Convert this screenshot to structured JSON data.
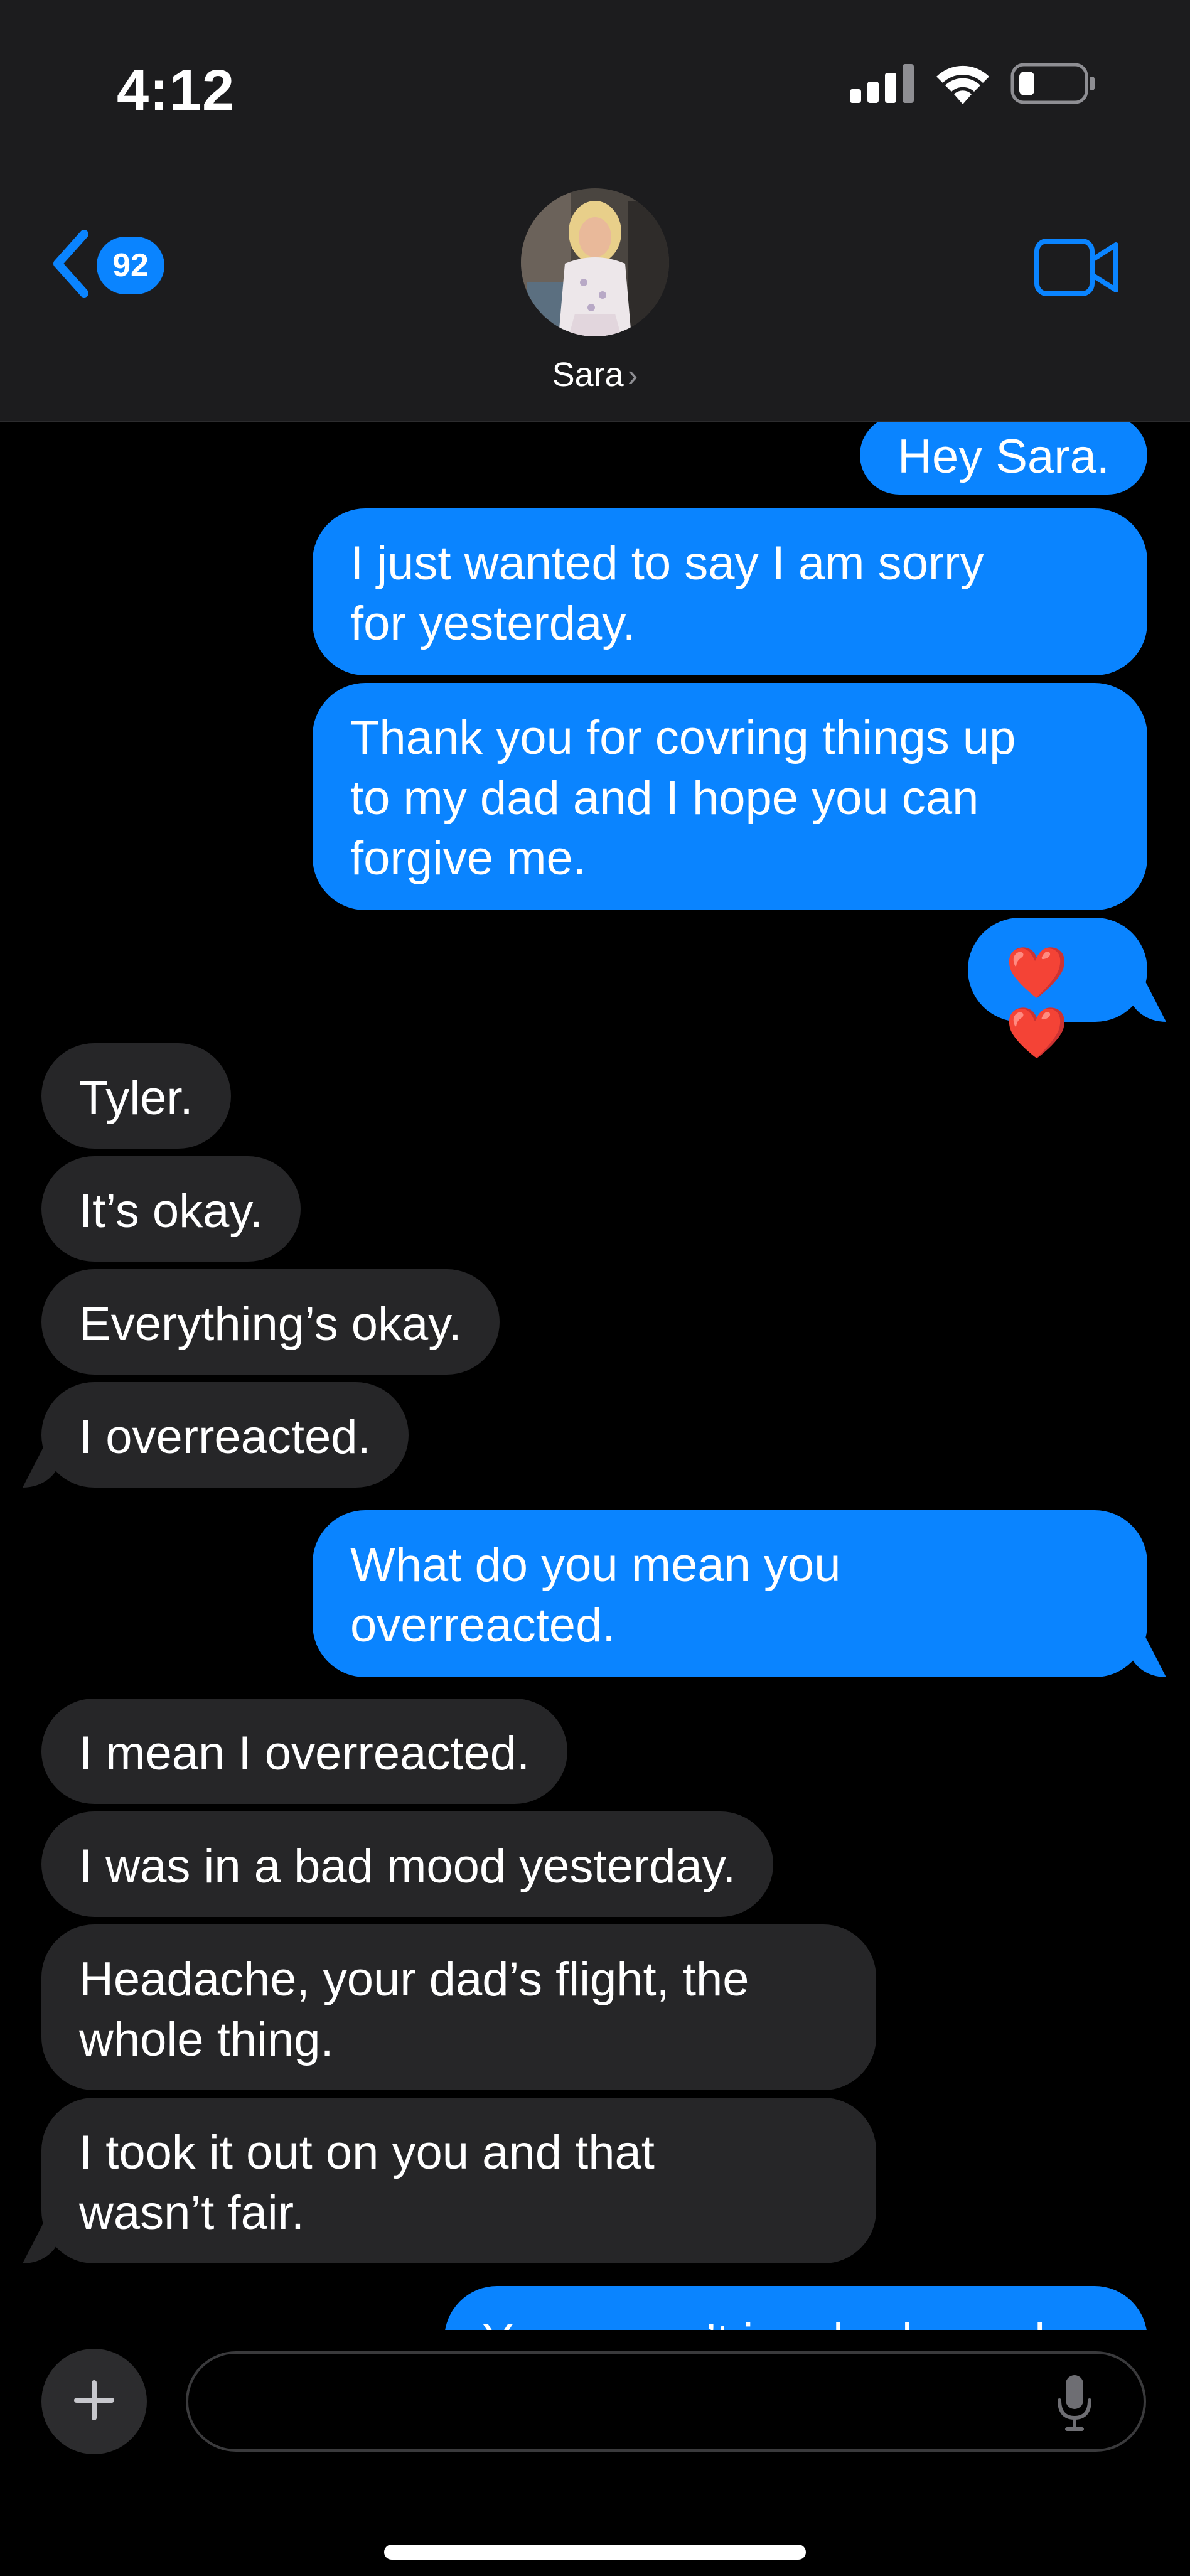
{
  "status_bar": {
    "time": "4:12"
  },
  "header": {
    "back_count": "92",
    "contact_name": "Sara",
    "accent_color": "#0a84ff"
  },
  "messages": [
    {
      "from": "me",
      "text": "Hey Sara."
    },
    {
      "from": "me",
      "text": "I just wanted to say I am sorry\nfor yesterday."
    },
    {
      "from": "me",
      "text": "Thank you for covring things up\nto my dad and I hope you can\nforgive me."
    },
    {
      "from": "me",
      "text": "❤️❤️"
    },
    {
      "from": "them",
      "text": "Tyler."
    },
    {
      "from": "them",
      "text": "It’s okay."
    },
    {
      "from": "them",
      "text": "Everything’s okay."
    },
    {
      "from": "them",
      "text": "I overreacted."
    },
    {
      "from": "me",
      "text": "What do you mean you\noverreacted."
    },
    {
      "from": "them",
      "text": "I mean I overreacted."
    },
    {
      "from": "them",
      "text": "I was in a bad mood yesterday."
    },
    {
      "from": "them",
      "text": "Headache, your dad’s flight, the\nwhole thing."
    },
    {
      "from": "them",
      "text": "I took it out on you and that\nwasn’t fair."
    },
    {
      "from": "me",
      "text": "You weren’t in a bad mood"
    }
  ],
  "composer": {
    "value": "",
    "placeholder": ""
  },
  "icons": [
    "signal-icon",
    "wifi-icon",
    "battery-icon",
    "back-chevron-icon",
    "video-camera-icon",
    "plus-icon",
    "microphone-icon"
  ]
}
